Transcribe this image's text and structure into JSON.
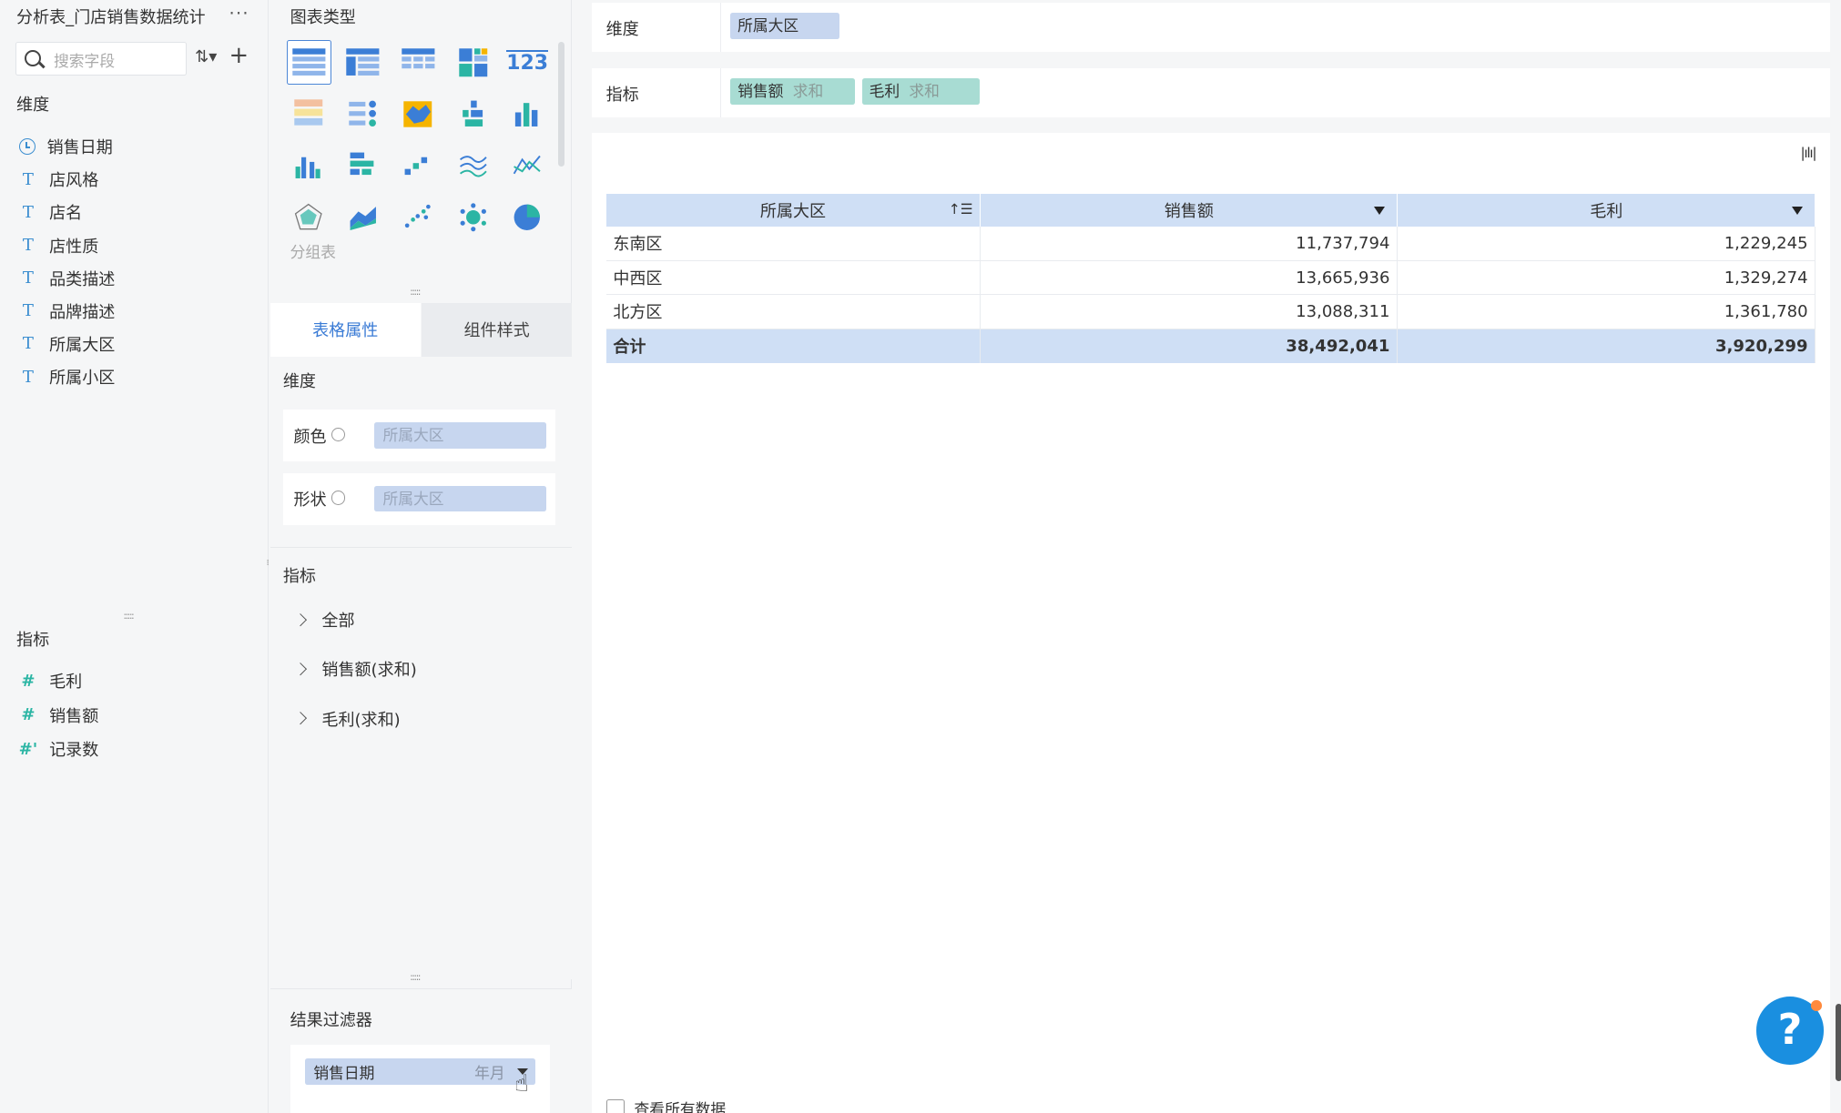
{
  "app": {
    "title": "分析表_门店销售数据统计",
    "more": "···"
  },
  "fields": {
    "search_placeholder": "搜索字段",
    "dimension_label": "维度",
    "dimensions": [
      {
        "name": "销售日期",
        "icon": "clock-icon"
      },
      {
        "name": "店风格",
        "icon": "text-icon"
      },
      {
        "name": "店名",
        "icon": "text-icon"
      },
      {
        "name": "店性质",
        "icon": "text-icon"
      },
      {
        "name": "品类描述",
        "icon": "text-icon"
      },
      {
        "name": "品牌描述",
        "icon": "text-icon"
      },
      {
        "name": "所属大区",
        "icon": "text-icon"
      },
      {
        "name": "所属小区",
        "icon": "text-icon"
      }
    ],
    "measure_label": "指标",
    "measures": [
      {
        "name": "毛利",
        "icon": "hash-icon"
      },
      {
        "name": "销售额",
        "icon": "hash-icon"
      },
      {
        "name": "记录数",
        "icon": "hash-count-icon"
      }
    ]
  },
  "chart_types": {
    "title": "图表类型",
    "hover_label": "分组表"
  },
  "property_tabs": {
    "active": "表格属性",
    "inactive": "组件样式"
  },
  "properties": {
    "dimension_label": "维度",
    "color_label": "颜色",
    "color_value": "所属大区",
    "shape_label": "形状",
    "shape_value": "所属大区",
    "measure_label": "指标",
    "tree": [
      "全部",
      "销售额(求和)",
      "毛利(求和)"
    ]
  },
  "filter": {
    "title": "结果过滤器",
    "field": "销售日期",
    "granularity": "年月"
  },
  "shelf": {
    "dimension_label": "维度",
    "dimension_pill": "所属大区",
    "measure_label": "指标",
    "measure_pills": [
      {
        "name": "销售额",
        "agg": "求和"
      },
      {
        "name": "毛利",
        "agg": "求和"
      }
    ]
  },
  "table": {
    "headers": [
      "所属大区",
      "销售额",
      "毛利"
    ],
    "rows": [
      [
        "东南区",
        "11,737,794",
        "1,229,245"
      ],
      [
        "中西区",
        "13,665,936",
        "1,329,274"
      ],
      [
        "北方区",
        "13,088,311",
        "1,361,780"
      ]
    ],
    "total": [
      "合计",
      "38,492,041",
      "3,920,299"
    ]
  },
  "footer": {
    "view_all": "查看所有数据"
  },
  "help": "?"
}
